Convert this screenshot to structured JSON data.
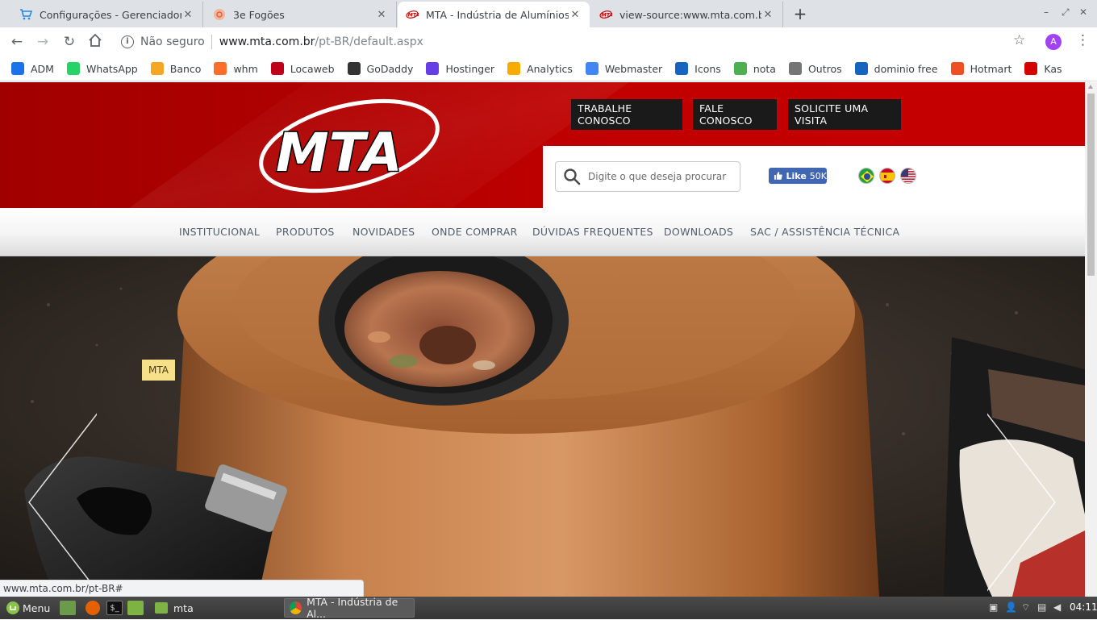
{
  "tabs": [
    {
      "title": "Configurações - Gerenciador W",
      "icon": "cart-icon"
    },
    {
      "title": "3e Fogões",
      "icon": "stove-icon"
    },
    {
      "title": "MTA - Indústria de Alumínios ®",
      "icon": "mta-favicon",
      "active": true
    },
    {
      "title": "view-source:www.mta.com.br/p",
      "icon": "mta-favicon"
    }
  ],
  "window_controls": {
    "minimize": "–",
    "restore": "⤢",
    "close": "✕"
  },
  "toolbar": {
    "security_label": "Não seguro",
    "url_host": "www.mta.com.br",
    "url_path": "/pt-BR/default.aspx",
    "profile_initial": "A"
  },
  "bookmarks": [
    {
      "label": "ADM",
      "icon": "cloud-icon",
      "color": "#1a73e8"
    },
    {
      "label": "WhatsApp",
      "icon": "whatsapp-icon",
      "color": "#25d366"
    },
    {
      "label": "Banco",
      "icon": "pma-icon",
      "color": "#f5a623"
    },
    {
      "label": "whm",
      "icon": "cpanel-icon",
      "color": "#ff6c2c"
    },
    {
      "label": "Locaweb",
      "icon": "locaweb-icon",
      "color": "#c0001a"
    },
    {
      "label": "GoDaddy",
      "icon": "godaddy-icon",
      "color": "#333333"
    },
    {
      "label": "Hostinger",
      "icon": "hostinger-icon",
      "color": "#673de6"
    },
    {
      "label": "Analytics",
      "icon": "analytics-icon",
      "color": "#f9ab00"
    },
    {
      "label": "Webmaster",
      "icon": "webmaster-icon",
      "color": "#4285f4"
    },
    {
      "label": "Icons",
      "icon": "flag-icon",
      "color": "#1565c0"
    },
    {
      "label": "nota",
      "icon": "nota-icon",
      "color": "#4caf50"
    },
    {
      "label": "Outros",
      "icon": "folder-icon",
      "color": "#757575"
    },
    {
      "label": "dominio free",
      "icon": "freenom-icon",
      "color": "#1565c0"
    },
    {
      "label": "Hotmart",
      "icon": "hotmart-icon",
      "color": "#f04e23"
    },
    {
      "label": "Kas",
      "icon": "kaspersky-icon",
      "color": "#d50000"
    }
  ],
  "site": {
    "brand": "MTA",
    "top_buttons": [
      "TRABALHE CONOSCO",
      "FALE CONOSCO",
      "SOLICITE UMA VISITA"
    ],
    "search_placeholder": "Digite o que deseja procurar",
    "fb_like_label": "Like",
    "fb_like_count": "50K",
    "languages": [
      "Português",
      "Español",
      "English"
    ],
    "nav": [
      "INSTITUCIONAL",
      "PRODUTOS",
      "NOVIDADES",
      "ONDE COMPRAR",
      "DÚVIDAS FREQUENTES",
      "DOWNLOADS",
      "SAC / ASSISTÊNCIA TÉCNICA"
    ],
    "hero_tag": "MTA",
    "brand_red": "#c40000"
  },
  "status_url": "www.mta.com.br/pt-BR#",
  "taskbar": {
    "menu_label": "Menu",
    "folder_label": "mta",
    "window_label": "MTA - Indústria de Al...",
    "clock": "04:11"
  }
}
